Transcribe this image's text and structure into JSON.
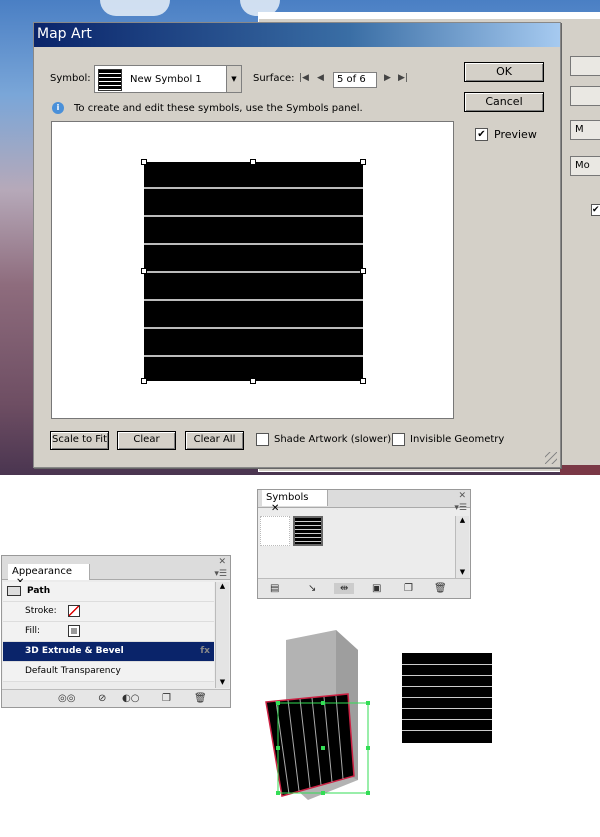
{
  "dialog": {
    "title": "Map Art",
    "symbol_label": "Symbol:",
    "symbol_value": "New Symbol 1",
    "surface_label": "Surface:",
    "surface_value": "5 of 6",
    "info_text": "To create and edit these symbols, use the Symbols panel.",
    "ok_label": "OK",
    "cancel_label": "Cancel",
    "preview_label": "Preview",
    "preview_checked": true,
    "scale_to_fit_label": "Scale to Fit",
    "clear_label": "Clear",
    "clear_all_label": "Clear All",
    "shade_artwork_label": "Shade Artwork (slower)",
    "invisible_geometry_label": "Invisible Geometry"
  },
  "background_window": {
    "buttons": [
      "",
      "",
      "M",
      "Mo"
    ]
  },
  "symbols_panel": {
    "tab": "Symbols"
  },
  "appearance_panel": {
    "tab": "Appearance",
    "rows": {
      "path": "Path",
      "stroke": "Stroke:",
      "fill": "Fill:",
      "effect": "3D Extrude & Bevel",
      "transparency": "Default Transparency"
    }
  },
  "colors": {
    "title_start": "#0a246a",
    "selection": "#0a246a",
    "selection_bbox": "#33dd55",
    "path_outline": "#cc2244"
  }
}
